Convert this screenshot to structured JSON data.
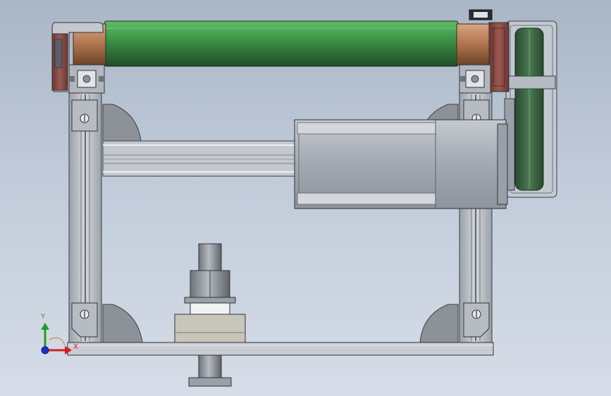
{
  "view": {
    "background": "#c1cbd9",
    "part_colors": {
      "frame": "#b9bec5",
      "frame_dark": "#8a9099",
      "roller": "#3f9a4a",
      "roller_dark": "#1f4d26",
      "bronze": "#b97d55",
      "housing": "#8e4f4a",
      "motor": "#a8aeb6",
      "belt": "#355f3c"
    }
  },
  "triad": {
    "x_label": "X",
    "y_label": "Y",
    "x_color": "#d41e1e",
    "y_color": "#1f9d2a",
    "z_color": "#1c2fd6"
  }
}
